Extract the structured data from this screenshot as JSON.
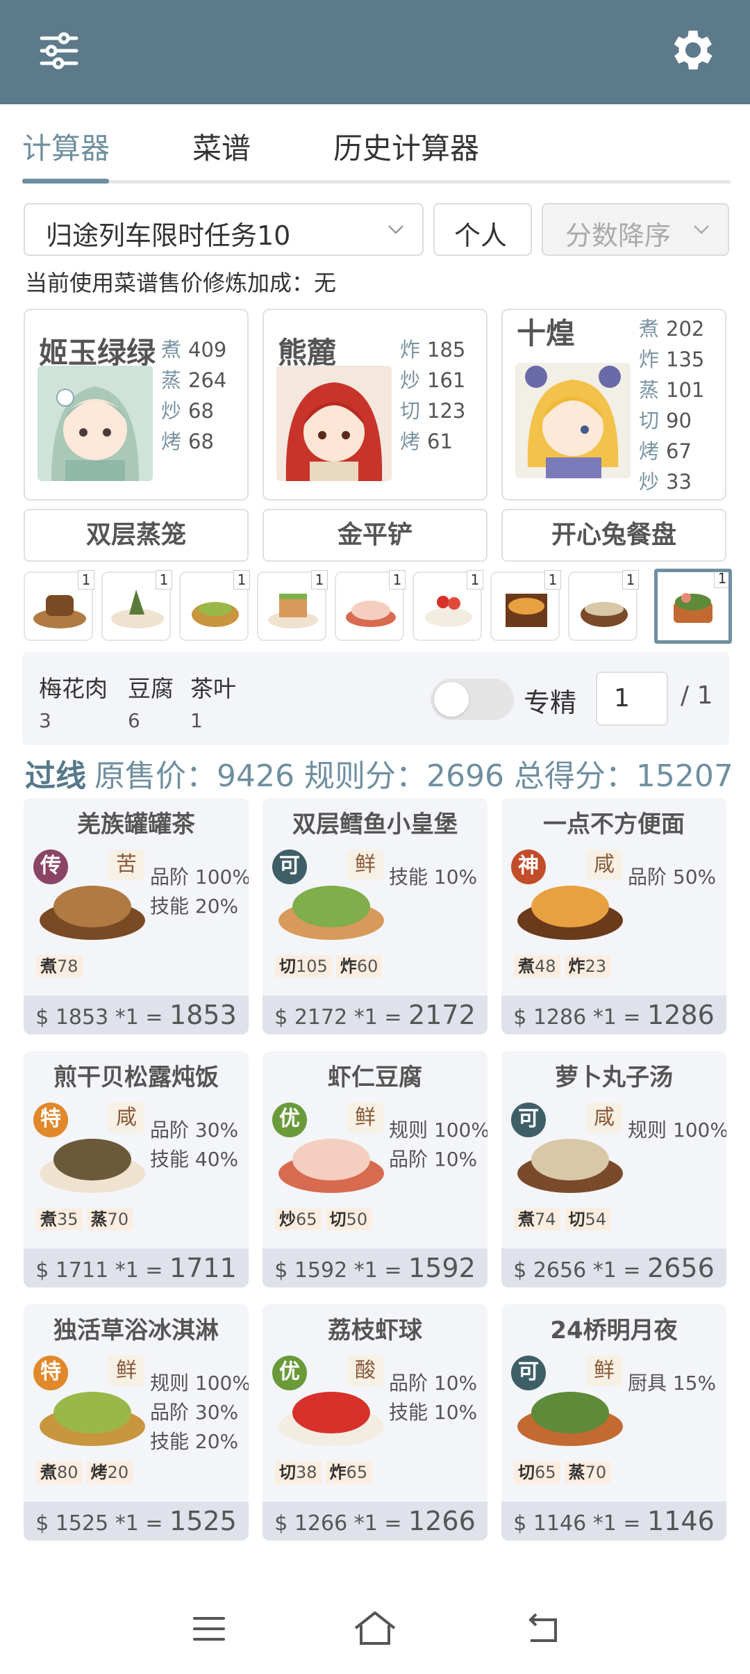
{
  "tabs": [
    {
      "label": "计算器",
      "active": true
    },
    {
      "label": "菜谱"
    },
    {
      "label": "历史计算器"
    }
  ],
  "filters": {
    "rule": "归途列车限时任务10",
    "mode": "个人",
    "sort": "分数降序"
  },
  "notice": "当前使用菜谱售价修炼加成：无",
  "chefs": [
    {
      "name": "姬玉绿绿",
      "stats": [
        [
          "煮",
          "409"
        ],
        [
          "蒸",
          "264"
        ],
        [
          "炒",
          "68"
        ],
        [
          "烤",
          "68"
        ]
      ]
    },
    {
      "name": "熊麓",
      "stats": [
        [
          "炸",
          "185"
        ],
        [
          "炒",
          "161"
        ],
        [
          "切",
          "123"
        ],
        [
          "烤",
          "61"
        ]
      ]
    },
    {
      "name": "十煌",
      "stats": [
        [
          "煮",
          "202"
        ],
        [
          "炸",
          "135"
        ],
        [
          "蒸",
          "101"
        ],
        [
          "切",
          "90"
        ],
        [
          "烤",
          "67"
        ],
        [
          "炒",
          "33"
        ]
      ]
    }
  ],
  "equipment": [
    "双层蒸笼",
    "金平铲",
    "开心兔餐盘"
  ],
  "dish_thumbs": [
    "1",
    "1",
    "1",
    "1",
    "1",
    "1",
    "1",
    "1",
    "1"
  ],
  "ingredients": [
    {
      "name": "梅花肉",
      "count": "3"
    },
    {
      "name": "豆腐",
      "count": "6"
    },
    {
      "name": "茶叶",
      "count": "1"
    }
  ],
  "specialty": {
    "label": "专精",
    "value": "1",
    "total": "/ 1",
    "enabled": false
  },
  "summary": {
    "status": "过线",
    "text": "原售价：9426 规则分：2696 总得分：15207"
  },
  "recipes": [
    {
      "name": "羌族罐罐茶",
      "rarity": "传",
      "rarity_color": "#8a4466",
      "taste": "苦",
      "bonuses": [
        "品阶 100%",
        "技能 20%"
      ],
      "skills": [
        [
          "煮",
          "78"
        ]
      ],
      "unit": "1853 *1 =",
      "total": "1853"
    },
    {
      "name": "双层鳕鱼小皇堡",
      "rarity": "可",
      "rarity_color": "#3f5f68",
      "taste": "鲜",
      "bonuses": [
        "技能 10%"
      ],
      "skills": [
        [
          "切",
          "105"
        ],
        [
          "炸",
          "60"
        ]
      ],
      "unit": "2172 *1 =",
      "total": "2172"
    },
    {
      "name": "一点不方便面",
      "rarity": "神",
      "rarity_color": "#c24d2a",
      "taste": "咸",
      "bonuses": [
        "品阶 50%"
      ],
      "skills": [
        [
          "煮",
          "48"
        ],
        [
          "炸",
          "23"
        ]
      ],
      "unit": "1286 *1 =",
      "total": "1286"
    },
    {
      "name": "煎干贝松露炖饭",
      "rarity": "特",
      "rarity_color": "#e0882a",
      "taste": "咸",
      "bonuses": [
        "品阶 30%",
        "技能 40%"
      ],
      "skills": [
        [
          "煮",
          "35"
        ],
        [
          "蒸",
          "70"
        ]
      ],
      "unit": "1711 *1 =",
      "total": "1711"
    },
    {
      "name": "虾仁豆腐",
      "rarity": "优",
      "rarity_color": "#6a9a3a",
      "taste": "鲜",
      "bonuses": [
        "规则 100%",
        "品阶 10%"
      ],
      "skills": [
        [
          "炒",
          "65"
        ],
        [
          "切",
          "50"
        ]
      ],
      "unit": "1592 *1 =",
      "total": "1592"
    },
    {
      "name": "萝卜丸子汤",
      "rarity": "可",
      "rarity_color": "#3f5f68",
      "taste": "咸",
      "bonuses": [
        "规则 100%"
      ],
      "skills": [
        [
          "煮",
          "74"
        ],
        [
          "切",
          "54"
        ]
      ],
      "unit": "2656 *1 =",
      "total": "2656"
    },
    {
      "name": "独活草浴冰淇淋",
      "rarity": "特",
      "rarity_color": "#e0882a",
      "taste": "鲜",
      "bonuses": [
        "规则 100%",
        "品阶 30%",
        "技能 20%"
      ],
      "skills": [
        [
          "煮",
          "80"
        ],
        [
          "烤",
          "20"
        ]
      ],
      "unit": "1525 *1 =",
      "total": "1525"
    },
    {
      "name": "荔枝虾球",
      "rarity": "优",
      "rarity_color": "#6a9a3a",
      "taste": "酸",
      "bonuses": [
        "品阶 10%",
        "技能 10%"
      ],
      "skills": [
        [
          "切",
          "38"
        ],
        [
          "炸",
          "65"
        ]
      ],
      "unit": "1266 *1 =",
      "total": "1266"
    },
    {
      "name": "24桥明月夜",
      "rarity": "可",
      "rarity_color": "#3f5f68",
      "taste": "鲜",
      "bonuses": [
        "厨具 15%"
      ],
      "skills": [
        [
          "切",
          "65"
        ],
        [
          "蒸",
          "70"
        ]
      ],
      "unit": "1146 *1 =",
      "total": "1146"
    }
  ],
  "icons": {
    "menu": "sliders-icon",
    "settings": "gear-icon",
    "nav": [
      "menu-icon",
      "home-icon",
      "back-icon"
    ]
  }
}
